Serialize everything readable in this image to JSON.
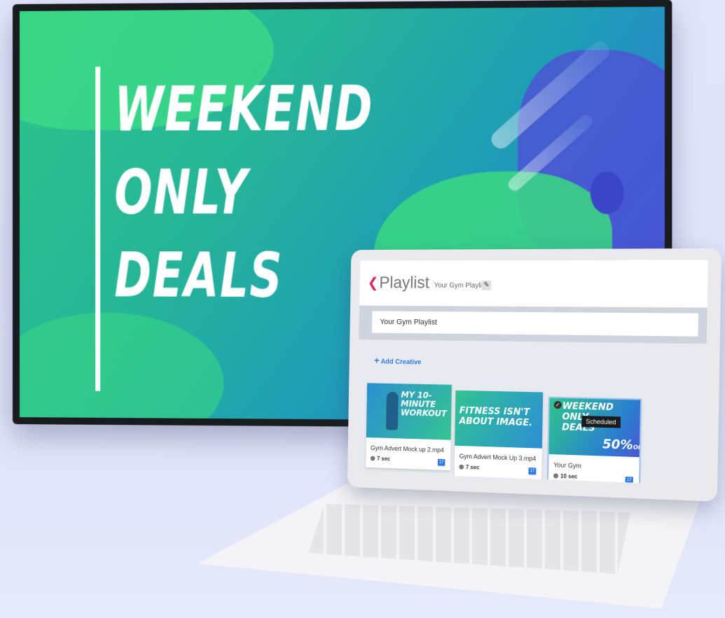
{
  "tv": {
    "headline": [
      "WEEKEND",
      "ONLY",
      "DEALS"
    ]
  },
  "app": {
    "back_icon": "chevron-left-icon",
    "title": "Playlist",
    "subtitle": "Your Gym Playlist *",
    "playlist_name_value": "Your Gym Playlist",
    "add_creative_label": "Add Creative",
    "accent_color": "#2f7be0",
    "back_color": "#e0245e"
  },
  "creatives": [
    {
      "thumb_text": [
        "MY 10-",
        "MINUTE",
        "WORKOUT"
      ],
      "name": "Gym Advert Mock up 2.mp4",
      "duration": "7 sec"
    },
    {
      "thumb_text": [
        "FITNESS ISN'T",
        "ABOUT IMAGE."
      ],
      "name": "Gym Advert Mock Up 3.mp4",
      "duration": "7 sec"
    },
    {
      "thumb_text": [
        "WEEKEND",
        "ONLY",
        "DEALS"
      ],
      "thumb_promo": "50%",
      "thumb_promo_suffix": "OFF",
      "status_tooltip": "Scheduled",
      "name": "Your Gym",
      "duration": "10 sec"
    }
  ]
}
